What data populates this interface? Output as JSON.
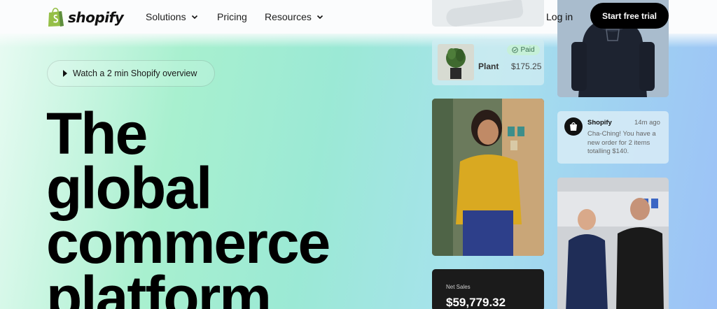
{
  "header": {
    "brand": "shopify",
    "nav": [
      {
        "label": "Solutions",
        "has_dropdown": true
      },
      {
        "label": "Pricing",
        "has_dropdown": false
      },
      {
        "label": "Resources",
        "has_dropdown": true
      }
    ],
    "login_label": "Log in",
    "cta_label": "Start free trial"
  },
  "hero": {
    "watch_label": "Watch a 2 min Shopify overview",
    "headline_lines": [
      "The",
      "global",
      "commerce",
      "platform"
    ]
  },
  "cards": {
    "order": {
      "status": "Paid",
      "product": "Plant",
      "price": "$175.25"
    },
    "notification": {
      "sender": "Shopify",
      "time": "14m ago",
      "message": "Cha-Ching! You have a new order for 2 items totalling $140."
    },
    "sales": {
      "label": "Net Sales",
      "value": "$59,779.32"
    }
  },
  "colors": {
    "brand_green": "#95bf47",
    "cta_bg": "#000000",
    "paid_badge": "#c6f0d8"
  }
}
